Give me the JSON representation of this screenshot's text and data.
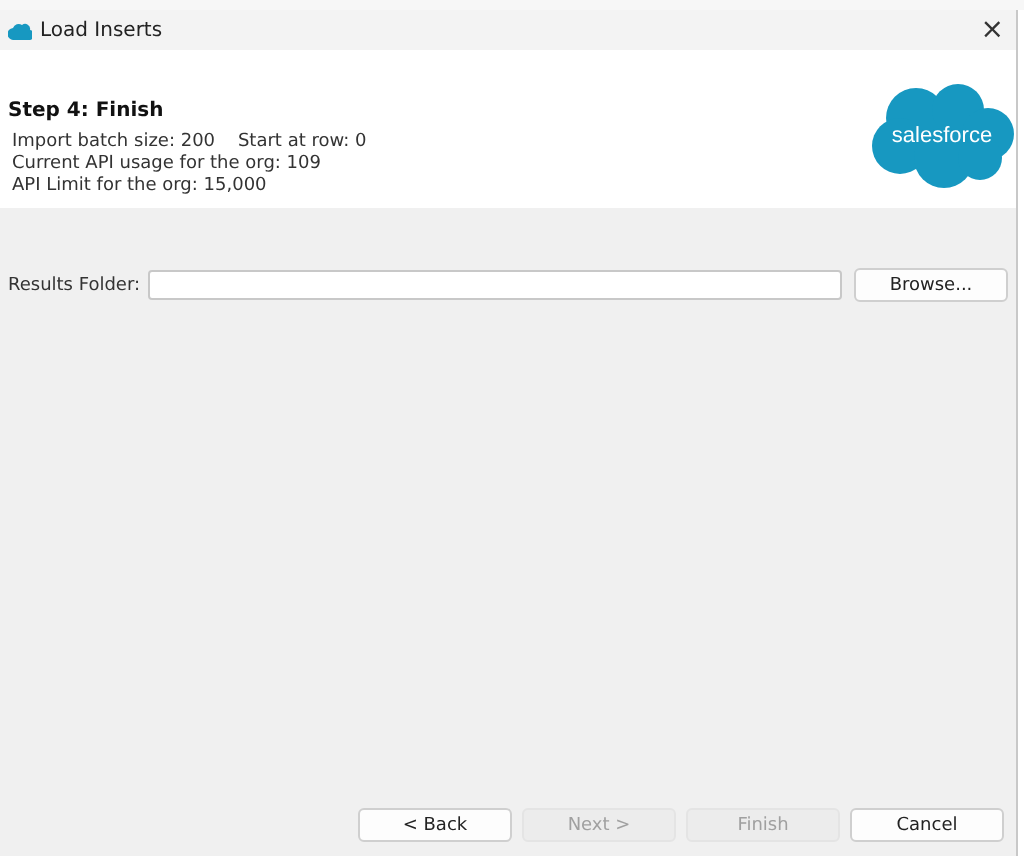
{
  "window": {
    "title": "Load Inserts",
    "close": "×"
  },
  "header": {
    "step": "Step 4: Finish",
    "lines": [
      "Import batch size: 200    Start at row: 0",
      "Current API usage for the org: 109",
      "API Limit for the org: 15,000"
    ],
    "logo": "salesforce"
  },
  "results_folder": {
    "label": "Results Folder:",
    "browse": "Browse..."
  },
  "buttons": [
    {
      "label": "< Back",
      "disabled": false
    },
    {
      "label": "Next >",
      "disabled": true
    },
    {
      "label": "Finish",
      "disabled": true
    },
    {
      "label": "Cancel",
      "disabled": false
    }
  ]
}
